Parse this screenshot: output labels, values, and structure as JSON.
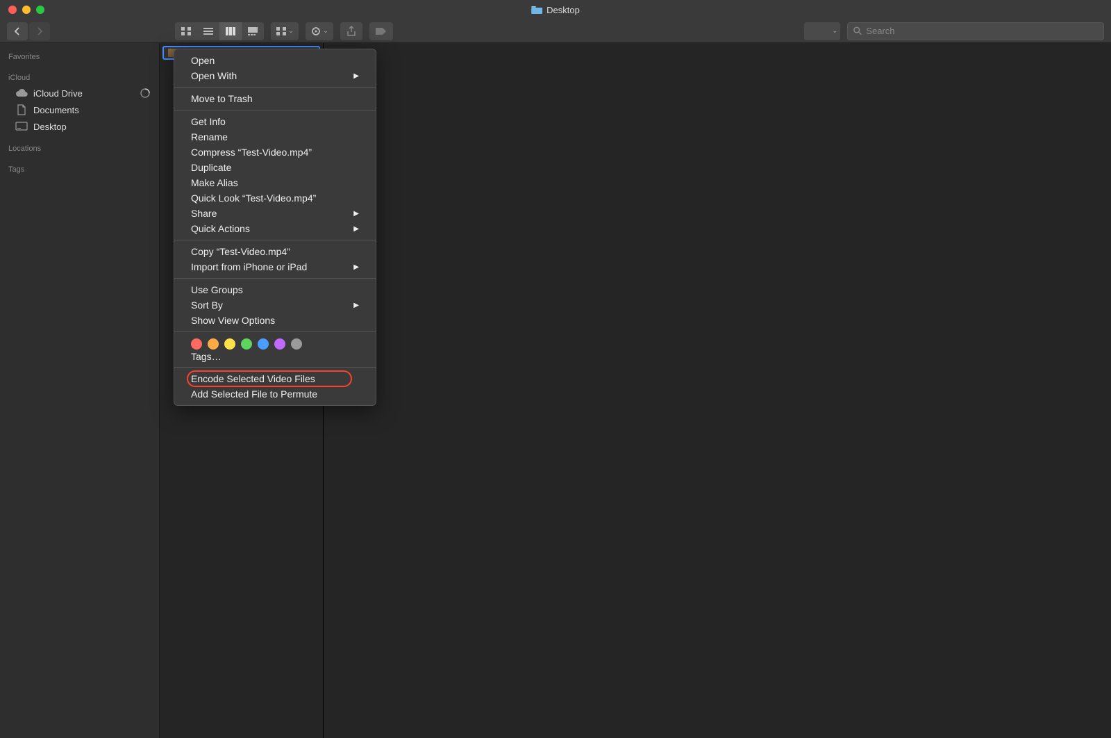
{
  "window": {
    "title": "Desktop"
  },
  "toolbar": {
    "search_placeholder": "Search"
  },
  "sidebar": {
    "sections": [
      {
        "header": "Favorites",
        "items": []
      },
      {
        "header": "iCloud",
        "items": [
          {
            "label": "iCloud Drive",
            "icon": "cloud",
            "extra": "pie"
          },
          {
            "label": "Documents",
            "icon": "doc"
          },
          {
            "label": "Desktop",
            "icon": "desktop"
          }
        ]
      },
      {
        "header": "Locations",
        "items": []
      },
      {
        "header": "Tags",
        "items": []
      }
    ]
  },
  "selected_file": "Test-Video.mp4",
  "context_menu": {
    "groups": [
      [
        {
          "label": "Open",
          "submenu": false
        },
        {
          "label": "Open With",
          "submenu": true
        }
      ],
      [
        {
          "label": "Move to Trash",
          "submenu": false
        }
      ],
      [
        {
          "label": "Get Info",
          "submenu": false
        },
        {
          "label": "Rename",
          "submenu": false
        },
        {
          "label": "Compress “Test-Video.mp4”",
          "submenu": false
        },
        {
          "label": "Duplicate",
          "submenu": false
        },
        {
          "label": "Make Alias",
          "submenu": false
        },
        {
          "label": "Quick Look “Test-Video.mp4”",
          "submenu": false
        },
        {
          "label": "Share",
          "submenu": true
        },
        {
          "label": "Quick Actions",
          "submenu": true
        }
      ],
      [
        {
          "label": "Copy “Test-Video.mp4”",
          "submenu": false
        },
        {
          "label": "Import from iPhone or iPad",
          "submenu": true
        }
      ],
      [
        {
          "label": "Use Groups",
          "submenu": false
        },
        {
          "label": "Sort By",
          "submenu": true
        },
        {
          "label": "Show View Options",
          "submenu": false
        }
      ]
    ],
    "tag_colors": [
      "#ff6b60",
      "#ffab45",
      "#ffe24a",
      "#5ed55e",
      "#4a9eff",
      "#c06bff",
      "#9a9a9a"
    ],
    "tags_label": "Tags…",
    "final_group": [
      {
        "label": "Encode Selected Video Files",
        "highlighted": true
      },
      {
        "label": "Add Selected File to Permute",
        "highlighted": false
      }
    ]
  }
}
